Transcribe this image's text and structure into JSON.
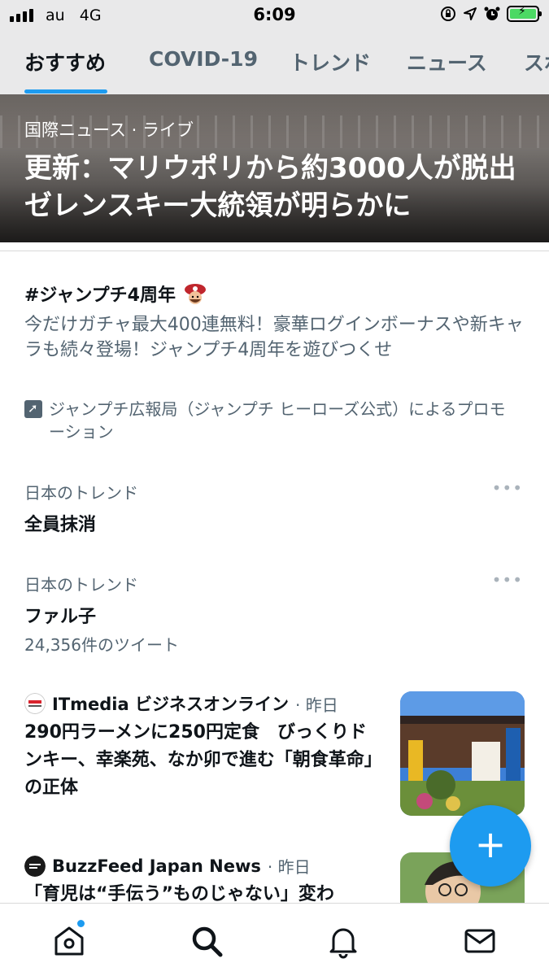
{
  "status_bar": {
    "carrier": "au",
    "network": "4G",
    "time": "6:09",
    "battery_color": "#4cd964"
  },
  "tabs": [
    {
      "label": "おすすめ",
      "active": true
    },
    {
      "label": "COVID-19",
      "active": false
    },
    {
      "label": "トレンド",
      "active": false
    },
    {
      "label": "ニュース",
      "active": false
    },
    {
      "label": "スポ",
      "active": false
    }
  ],
  "hero": {
    "source": "国際ニュース · ライブ",
    "title": "更新：マリウポリから約3000人が脱出 ゼレンスキー大統領が明らかに"
  },
  "promoted": {
    "title": "#ジャンプチ4周年",
    "description": "今だけガチャ最大400連無料！豪華ログインボーナスや新キャラも続々登場！ジャンプチ4周年を遊びつくせ",
    "by": "ジャンプチ広報局（ジャンプチ ヒーローズ公式）によるプロモーション"
  },
  "trends": [
    {
      "category": "日本のトレンド",
      "name": "全員抹消",
      "count": ""
    },
    {
      "category": "日本のトレンド",
      "name": "ファル子",
      "count": "24,356件のツイート"
    }
  ],
  "news": [
    {
      "source": "ITmedia ビジネスオンライン",
      "time": "· 昨日",
      "title": "290円ラーメンに250円定食　びっくりドンキー、幸楽苑、なか卯で進む「朝食革命」の正体"
    },
    {
      "source": "BuzzFeed Japan News",
      "time": "· 昨日",
      "title": "「育児は“手伝う”ものじゃない」変わ"
    }
  ],
  "icons": {
    "fab": "compose-plus-icon",
    "nav": [
      "home-icon",
      "search-icon",
      "bell-icon",
      "mail-icon"
    ]
  },
  "colors": {
    "accent": "#1d9bf0",
    "secondary_text": "#536471"
  }
}
